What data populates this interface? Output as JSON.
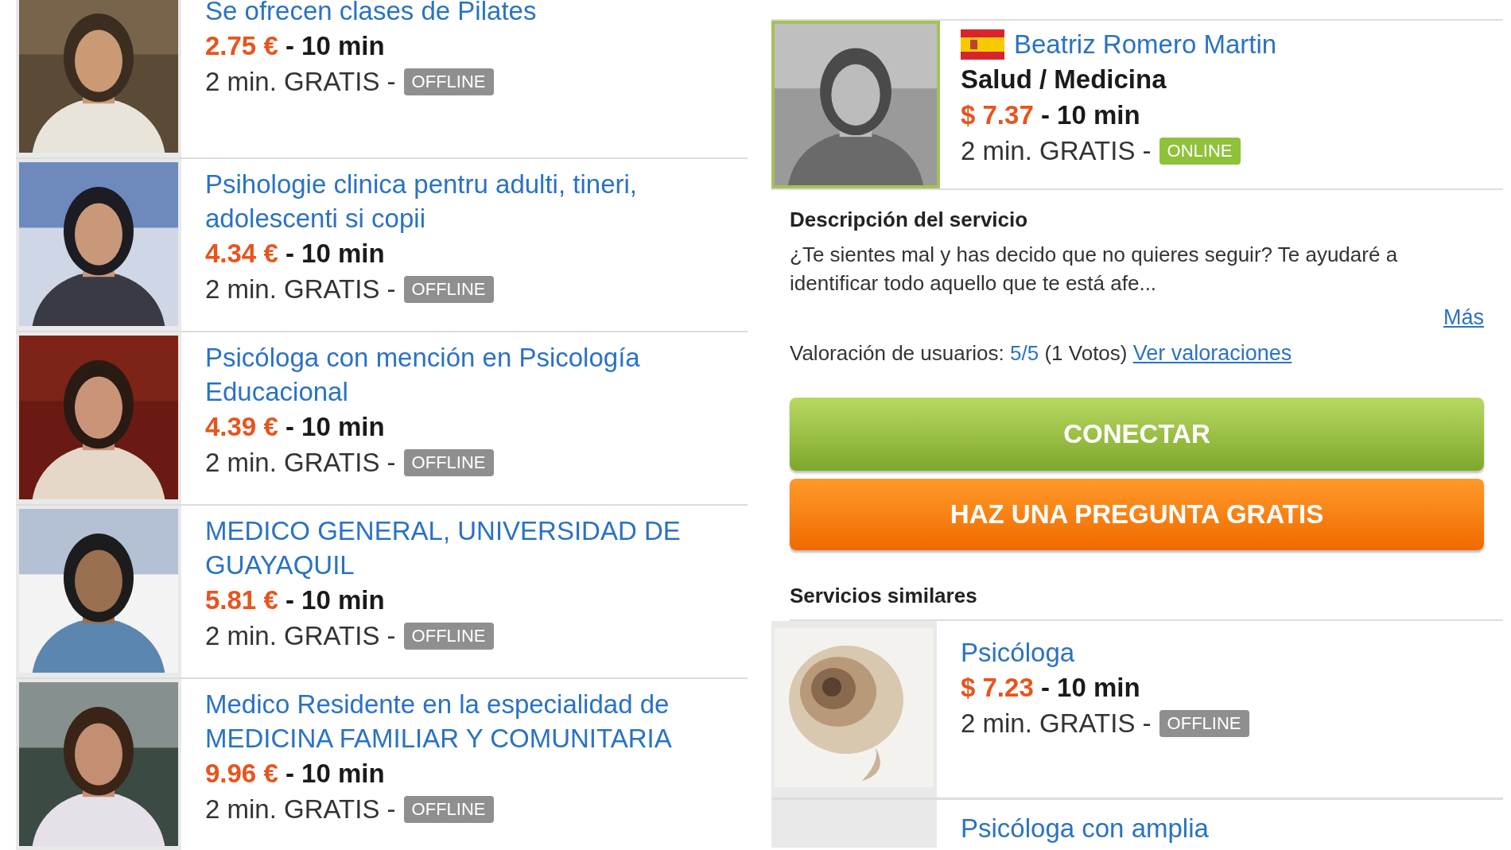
{
  "services": [
    {
      "title": "Se ofrecen clases de Pilates",
      "price": "2.75 €",
      "duration": " - 10 min",
      "free": "2 min. GRATIS -",
      "status": "OFFLINE",
      "online": false
    },
    {
      "title": "Psihologie clinica pentru adulti, tineri, adolescenti si copii",
      "price": "4.34 €",
      "duration": " - 10 min",
      "free": "2 min. GRATIS -",
      "status": "OFFLINE",
      "online": false
    },
    {
      "title": "Psicóloga con mención en Psicología Educacional",
      "price": "4.39 €",
      "duration": " - 10 min",
      "free": "2 min. GRATIS -",
      "status": "OFFLINE",
      "online": false
    },
    {
      "title": "MEDICO GENERAL, UNIVERSIDAD DE GUAYAQUIL",
      "price": "5.81 €",
      "duration": " - 10 min",
      "free": "2 min. GRATIS -",
      "status": "OFFLINE",
      "online": false
    },
    {
      "title": "Medico Residente en la especialidad de MEDICINA FAMILIAR Y COMUNITARIA",
      "price": "9.96 €",
      "duration": " - 10 min",
      "free": "2 min. GRATIS -",
      "status": "OFFLINE",
      "online": false
    }
  ],
  "detail": {
    "name": "Beatriz Romero Martin",
    "category": "Salud / Medicina",
    "price": "$ 7.37",
    "duration": " - 10 min",
    "free": "2 min. GRATIS -",
    "status": "ONLINE",
    "online": true,
    "description_heading": "Descripción del servicio",
    "description": "¿Te sientes mal y has decido que no quieres seguir? Te ayudaré a identificar todo aquello que te está afe...",
    "more_link": "Más",
    "rating_label": "Valoración de usuarios:",
    "rating": "5/5",
    "votes": "(1 Votos)",
    "ratings_link": "Ver valoraciones",
    "connect_button": "CONECTAR",
    "ask_button": "HAZ UNA PREGUNTA GRATIS"
  },
  "similar": {
    "heading": "Servicios similares",
    "items": [
      {
        "title": "Psicóloga",
        "price": "$ 7.23",
        "duration": " - 10 min",
        "free": "2 min. GRATIS -",
        "status": "OFFLINE",
        "online": false
      },
      {
        "title": "Psicóloga con amplia"
      }
    ]
  }
}
